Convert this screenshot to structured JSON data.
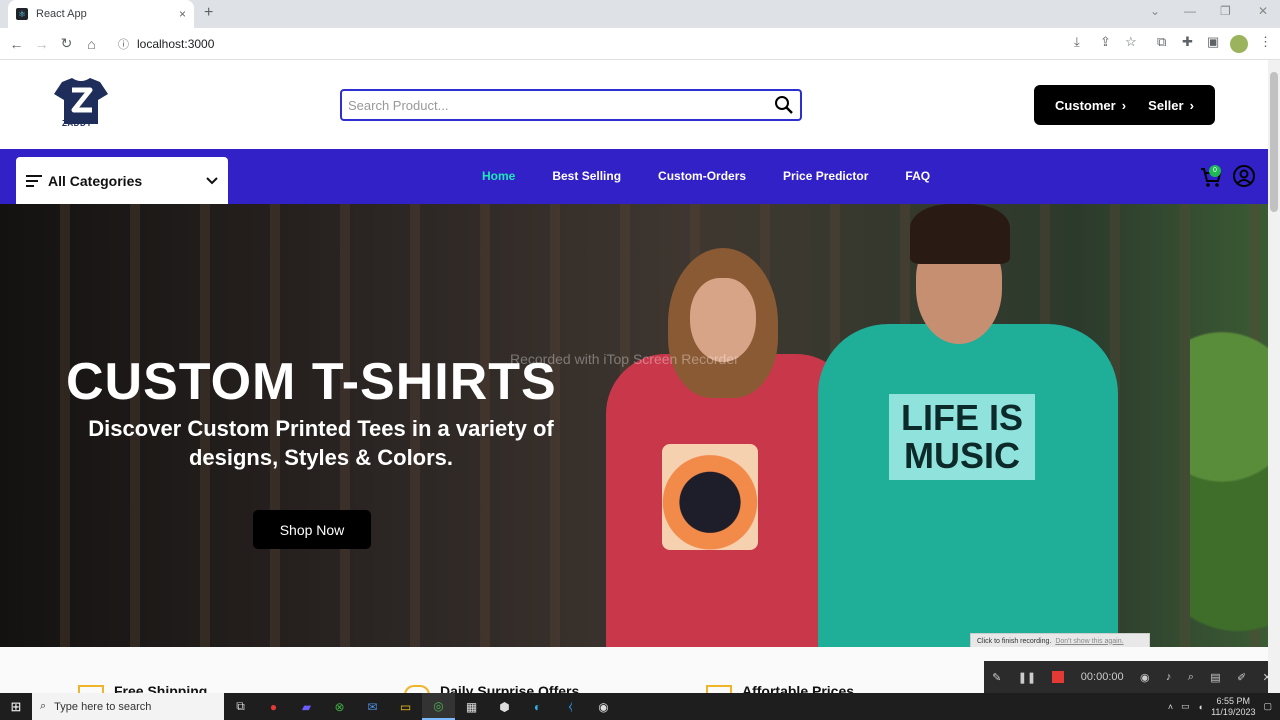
{
  "browser": {
    "tab_title": "React App",
    "tab_close": "×",
    "new_tab": "+",
    "url": "localhost:3000",
    "window_controls": [
      "⌄",
      "—",
      "❐",
      "✕"
    ]
  },
  "header": {
    "logo_text": "ZADDY",
    "search_placeholder": "Search Product...",
    "customer_label": "Customer",
    "seller_label": "Seller"
  },
  "nav": {
    "categories_label": "All Categories",
    "links": [
      {
        "label": "Home",
        "active": true
      },
      {
        "label": "Best Selling",
        "active": false
      },
      {
        "label": "Custom-Orders",
        "active": false
      },
      {
        "label": "Price Predictor",
        "active": false
      },
      {
        "label": "FAQ",
        "active": false
      }
    ],
    "cart_count": "0"
  },
  "hero": {
    "title": "CUSTOM T-SHIRTS",
    "subtitle": "Discover Custom Printed Tees in a variety of designs, Styles & Colors.",
    "cta": "Shop Now",
    "shirt_text_line1": "LIFE IS",
    "shirt_text_line2": "MUSIC",
    "watermark": "Recorded with iTop Screen Recorder"
  },
  "features": [
    {
      "label": "Free Shipping"
    },
    {
      "label": "Daily Surprise Offers"
    },
    {
      "label": "Affortable Prices"
    }
  ],
  "recorder": {
    "tip": "Click to finish recording.",
    "tip_link": "Don't show this again.",
    "time": "00:00:00"
  },
  "taskbar": {
    "search_placeholder": "Type here to search",
    "time": "6:55 PM",
    "date": "11/19/2023"
  },
  "colors": {
    "nav_bg": "#3321c8",
    "active_link": "#1de9b6",
    "search_border": "#2d2fd1"
  }
}
